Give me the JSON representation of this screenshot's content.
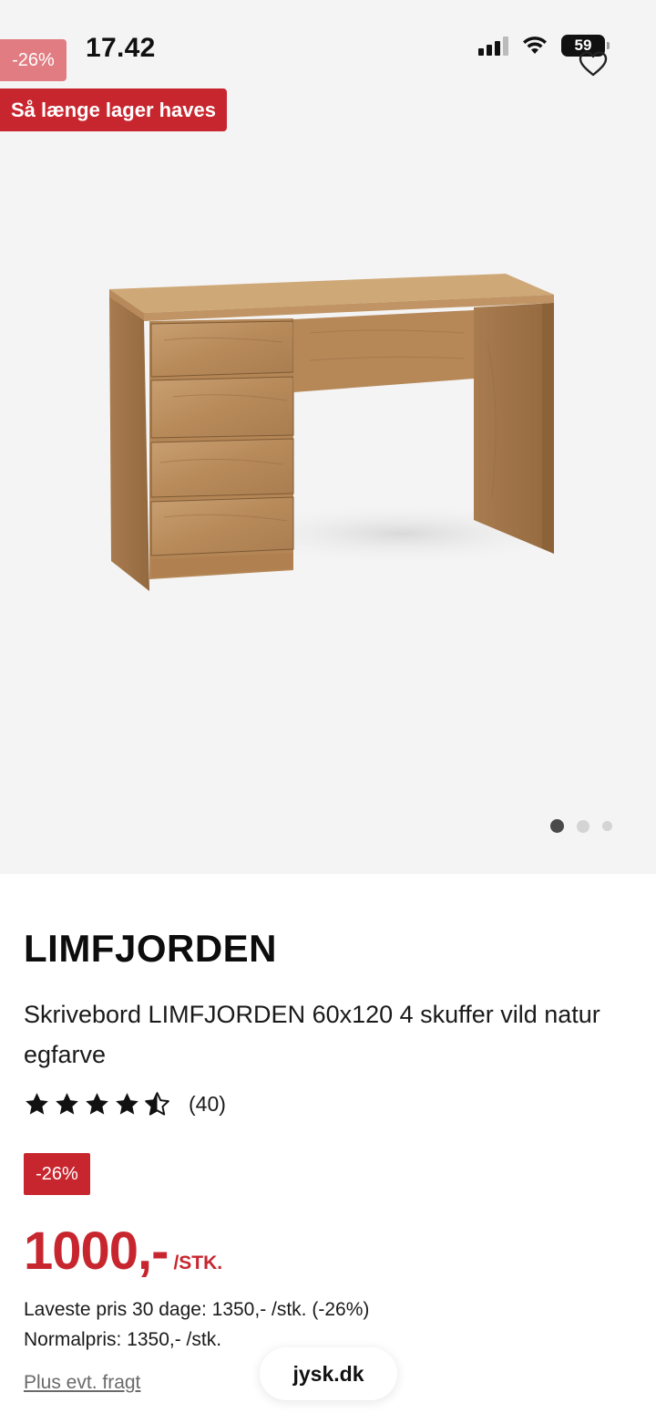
{
  "status_bar": {
    "time": "17.42",
    "battery": "59"
  },
  "hero": {
    "discount_badge": "-26%",
    "stock_badge": "Så længe lager haves",
    "image_alt_icon": "desk-product-image",
    "carousel": {
      "count": 3,
      "active": 0
    }
  },
  "product": {
    "brand": "LIMFJORDEN",
    "name": "Skrivebord LIMFJORDEN 60x120 4 skuffer vild natur egfarve",
    "rating": 4.5,
    "rating_count": "(40)",
    "discount_badge": "-26%",
    "price": "1000,-",
    "price_unit": "/STK.",
    "lowest_price": "Laveste pris 30 dage: 1350,- /stk. (-26%)",
    "normal_price": "Normalpris: 1350,- /stk.",
    "shipping_note": "Plus evt. fragt"
  },
  "browser": {
    "url": "jysk.dk"
  },
  "colors": {
    "brand_red": "#c8262f",
    "faded_red": "#e07c82",
    "hero_bg": "#f4f4f4"
  }
}
